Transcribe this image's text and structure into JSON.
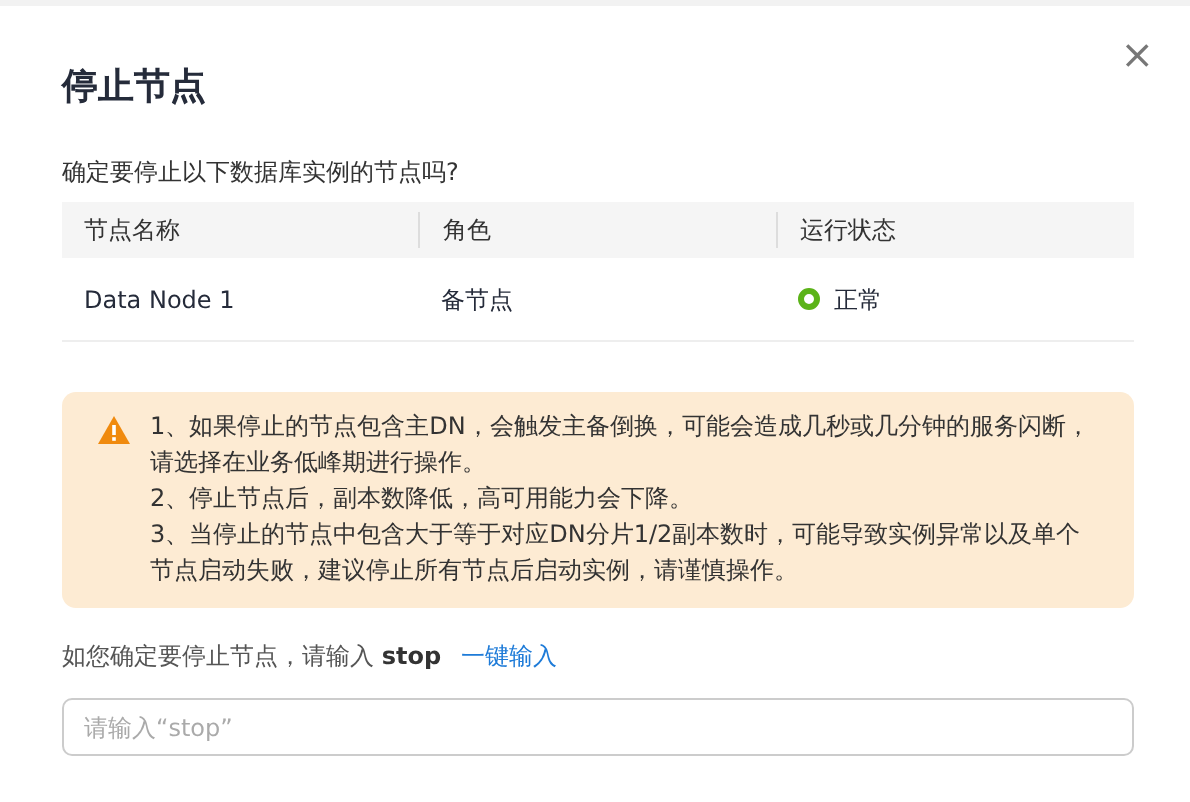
{
  "dialog": {
    "title": "停止节点",
    "close_label": "×"
  },
  "question": "确定要停止以下数据库实例的节点吗?",
  "table": {
    "columns": [
      "节点名称",
      "角色",
      "运行状态"
    ],
    "rows": [
      {
        "name": "Data Node 1",
        "role": "备节点",
        "status": {
          "text": "正常",
          "color": "#5bb318"
        }
      }
    ]
  },
  "warning": {
    "items": [
      "1、如果停止的节点包含主DN，会触发主备倒换，可能会造成几秒或几分钟的服务闪断，请选择在业务低峰期进行操作。",
      "2、停止节点后，副本数降低，高可用能力会下降。",
      "3、当停止的节点中包含大于等于对应DN分片1/2副本数时，可能导致实例异常以及单个节点启动失败，建议停止所有节点后启动实例，请谨慎操作。"
    ]
  },
  "confirm": {
    "prompt": "如您确定要停止节点，请输入 **stop**",
    "link": "一键输入",
    "placeholder": "请输入“stop”"
  }
}
